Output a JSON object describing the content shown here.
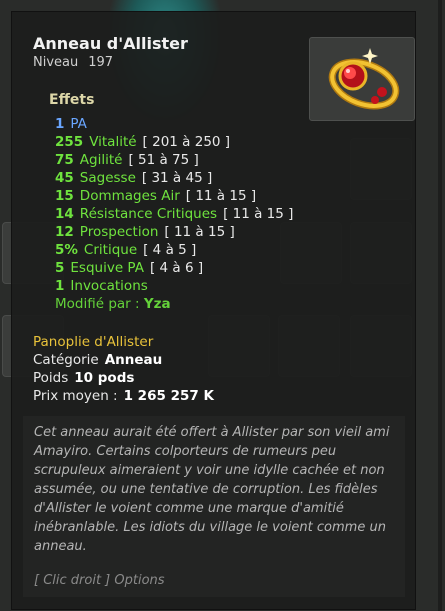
{
  "item": {
    "name": "Anneau d'Allister",
    "level_label": "Niveau",
    "level_value": "197"
  },
  "effects": {
    "header": "Effets",
    "lines": [
      {
        "value": "1",
        "label": "PA",
        "range": ""
      },
      {
        "value": "255",
        "label": "Vitalité",
        "range": "[ 201 à 250 ]"
      },
      {
        "value": "75",
        "label": "Agilité",
        "range": "[ 51 à 75 ]"
      },
      {
        "value": "45",
        "label": "Sagesse",
        "range": "[ 31 à 45 ]"
      },
      {
        "value": "15",
        "label": "Dommages Air",
        "range": "[ 11 à 15 ]"
      },
      {
        "value": "14",
        "label": "Résistance Critiques",
        "range": "[ 11 à 15 ]"
      },
      {
        "value": "12",
        "label": "Prospection",
        "range": "[ 11 à 15 ]"
      },
      {
        "value": "5%",
        "label": "Critique",
        "range": "[ 4 à 5 ]"
      },
      {
        "value": "5",
        "label": "Esquive PA",
        "range": "[ 4 à 6 ]"
      },
      {
        "value": "1",
        "label": "Invocations",
        "range": ""
      }
    ],
    "modified_label": "Modifié par :",
    "modified_value": "Yza"
  },
  "details": {
    "set_name": "Panoplie d'Allister",
    "category_label": "Catégorie",
    "category_value": "Anneau",
    "weight_label": "Poids",
    "weight_value": "10 pods",
    "price_label": "Prix moyen :",
    "price_value": "1 265 257 K"
  },
  "description": "Cet anneau aurait été offert à Allister par son vieil ami Amayiro. Certains colporteurs de rumeurs peu scrupuleux aimeraient y voir une idylle cachée et non assumée, ou une tentative de corruption. Les fidèles d'Allister le voient comme une marque d'amitié inébranlable. Les idiots du village le voient comme un anneau.",
  "hint": "[ Clic droit ] Options",
  "colors": {
    "title": "#f2f2f2",
    "effect_blue": "#6aa6ff",
    "effect_green": "#6fe33e",
    "set_gold": "#e8c23a"
  }
}
